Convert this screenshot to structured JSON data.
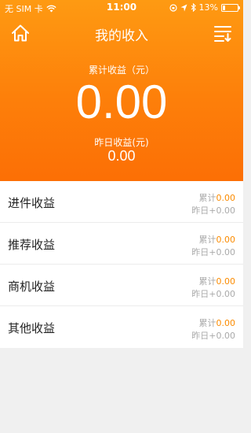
{
  "status_bar": {
    "carrier": "无 SIM 卡",
    "time": "11:00",
    "battery": "13%"
  },
  "nav": {
    "title": "我的收入",
    "home_icon": "home-icon",
    "menu_icon": "list-menu-icon"
  },
  "summary": {
    "total_label": "累计收益（元）",
    "total_value": "0.00",
    "yesterday_label": "昨日收益(元)",
    "yesterday_value": "0.00"
  },
  "items": [
    {
      "name": "进件收益",
      "total_prefix": "累计",
      "total": "0.00",
      "yesterday": "昨日+0.00"
    },
    {
      "name": "推荐收益",
      "total_prefix": "累计",
      "total": "0.00",
      "yesterday": "昨日+0.00"
    },
    {
      "name": "商机收益",
      "total_prefix": "累计",
      "total": "0.00",
      "yesterday": "昨日+0.00"
    },
    {
      "name": "其他收益",
      "total_prefix": "累计",
      "total": "0.00",
      "yesterday": "昨日+0.00"
    }
  ],
  "colors": {
    "accent": "#fb8b00",
    "header_top": "#fe9a12",
    "header_bottom": "#fc6f05"
  }
}
